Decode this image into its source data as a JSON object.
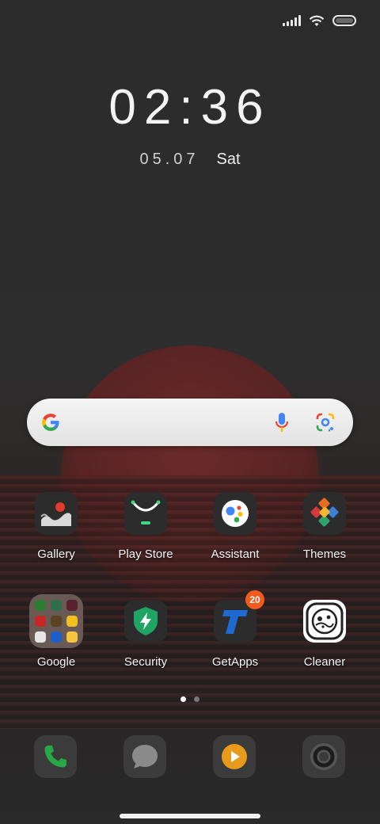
{
  "status_bar": {
    "icons": [
      "signal-icon",
      "wifi-icon",
      "battery-icon"
    ]
  },
  "lockclock": {
    "time": "02:36",
    "date": "05.07",
    "day": "Sat"
  },
  "search_bar": {
    "icons": [
      "google-g-icon",
      "voice-mic-icon",
      "google-lens-icon"
    ]
  },
  "apps_row1": [
    {
      "label": "Gallery",
      "icon": "gallery-icon"
    },
    {
      "label": "Play Store",
      "icon": "play-store-icon"
    },
    {
      "label": "Assistant",
      "icon": "assistant-icon"
    },
    {
      "label": "Themes",
      "icon": "themes-icon"
    }
  ],
  "apps_row2": [
    {
      "label": "Google",
      "icon": "google-folder-icon"
    },
    {
      "label": "Security",
      "icon": "security-shield-icon"
    },
    {
      "label": "GetApps",
      "icon": "getapps-icon",
      "badge": "20"
    },
    {
      "label": "Cleaner",
      "icon": "cleaner-icon"
    }
  ],
  "pager": {
    "pages": 2,
    "current": 1
  },
  "dock": [
    {
      "icon": "phone-icon"
    },
    {
      "icon": "messaging-icon"
    },
    {
      "icon": "music-icon"
    },
    {
      "icon": "camera-icon"
    }
  ],
  "colors": {
    "badge": "#f25a1e",
    "security_green": "#1fa463",
    "getapps_blue": "#1e6ad1",
    "music_orange": "#e89a1b",
    "phone_green": "#28a745"
  }
}
